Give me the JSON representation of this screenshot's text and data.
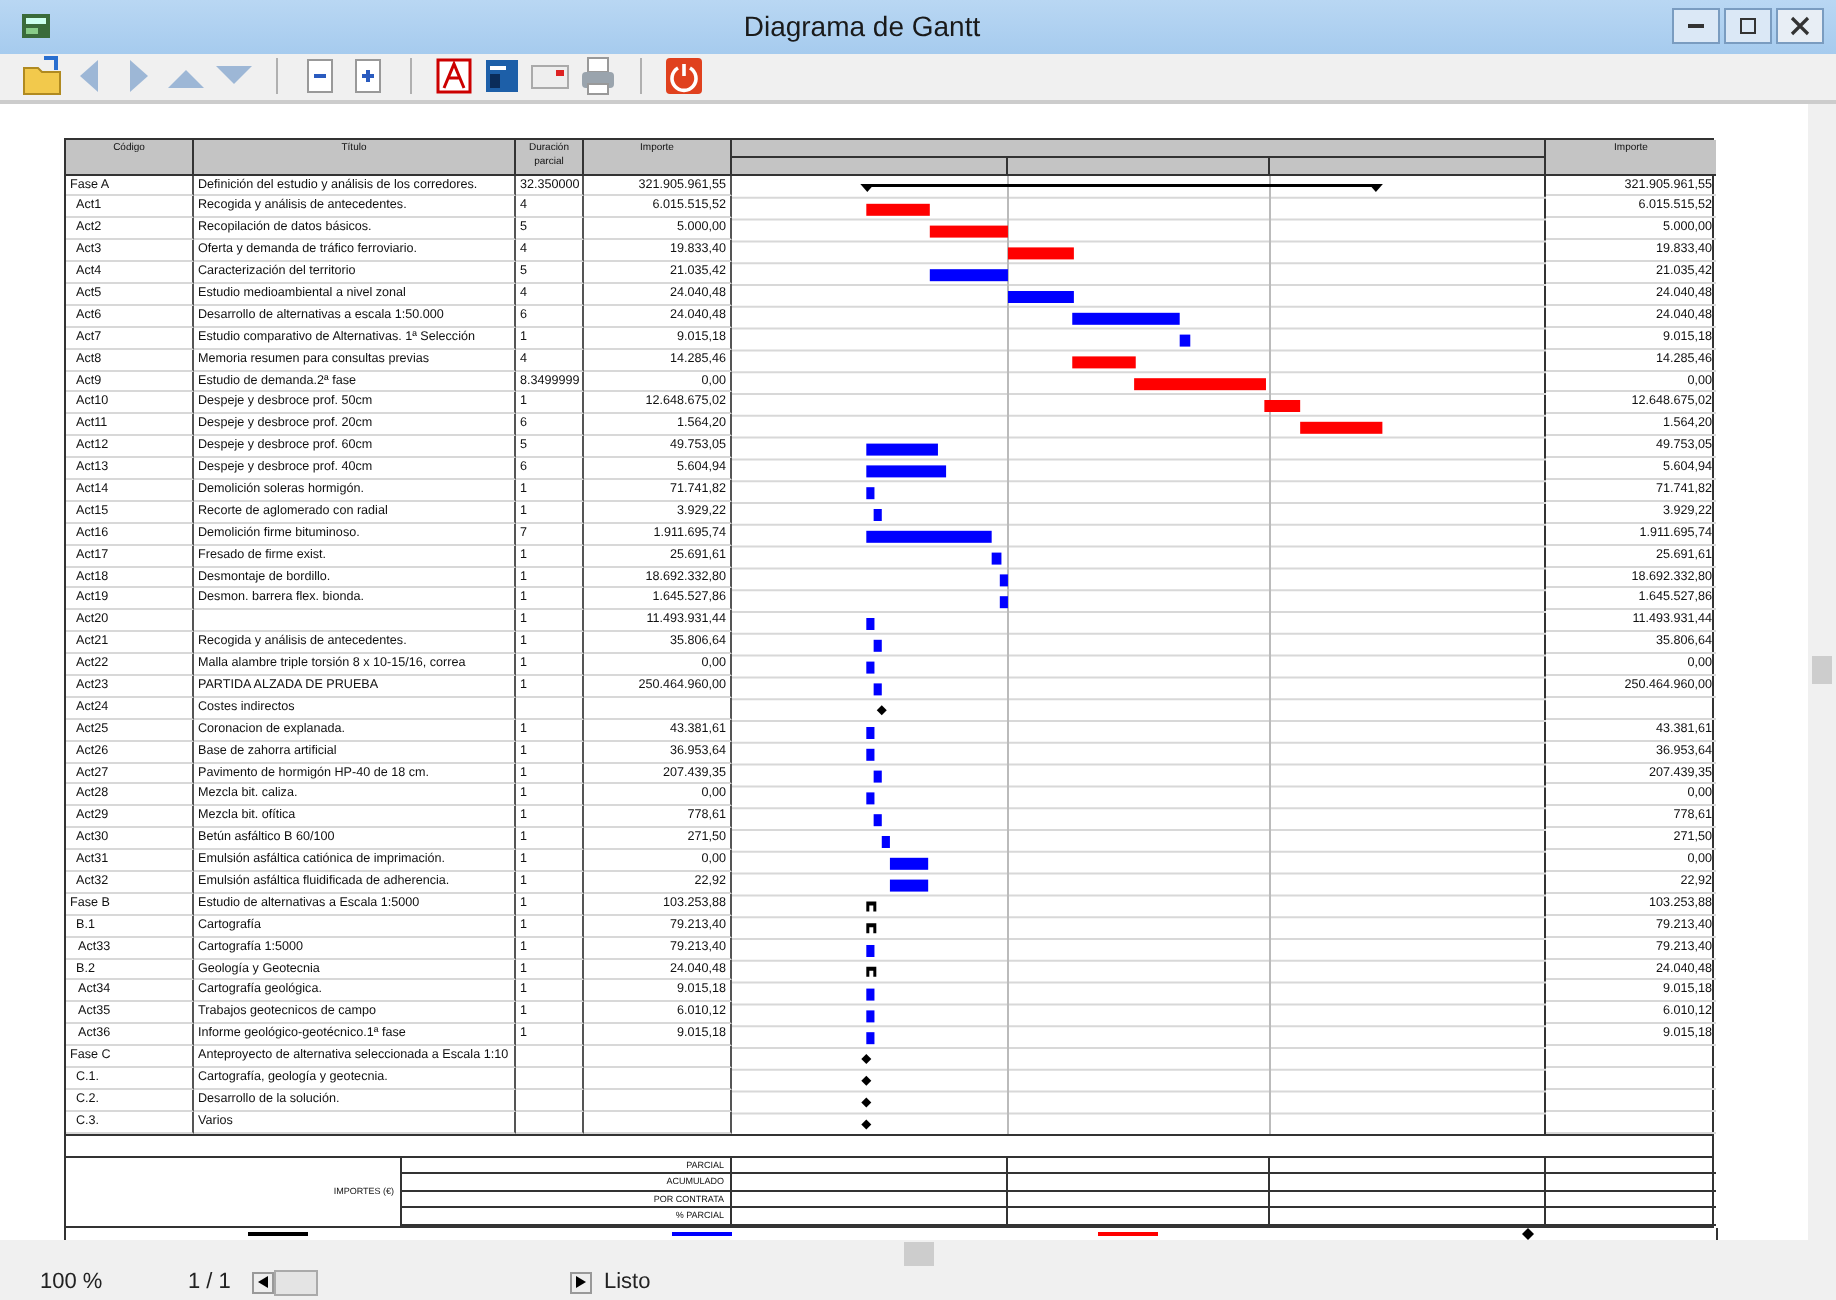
{
  "window": {
    "title": "Diagrama de Gantt"
  },
  "toolbar": [
    {
      "kind": "export"
    },
    {
      "kind": "left"
    },
    {
      "kind": "right"
    },
    {
      "kind": "up"
    },
    {
      "kind": "down"
    },
    {
      "kind": "sep"
    },
    {
      "kind": "zoomout"
    },
    {
      "kind": "zoomin"
    },
    {
      "kind": "sep"
    },
    {
      "kind": "pdf"
    },
    {
      "kind": "sheet"
    },
    {
      "kind": "mail"
    },
    {
      "kind": "print"
    },
    {
      "kind": "sep"
    },
    {
      "kind": "power"
    }
  ],
  "table": {
    "columns": [
      "Código",
      "Título",
      "Duración parcial",
      "Importe",
      "Importe"
    ],
    "rows": [
      {
        "code": "Fase A",
        "title": "Definición del estudio y análisis de los corredores.",
        "duration": "32.350000",
        "amount": "321.905.961,55",
        "total": "321.905.961,55",
        "kind": "summary",
        "children": [
          {
            "code": "Act1",
            "title": "Recogida y análisis de antecedentes.",
            "duration": "4",
            "amount": "6.015.515,52",
            "total": "6.015.515,52",
            "kind": "critical"
          },
          {
            "code": "Act2",
            "title": "Recopilación de datos básicos.",
            "duration": "5",
            "amount": "5.000,00",
            "total": "5.000,00",
            "kind": "critical"
          },
          {
            "code": "Act3",
            "title": "Oferta y demanda de tráfico ferroviario.",
            "duration": "4",
            "amount": "19.833,40",
            "total": "19.833,40",
            "kind": "critical"
          },
          {
            "code": "Act4",
            "title": "Caracterización del territorio",
            "duration": "5",
            "amount": "21.035,42",
            "total": "21.035,42",
            "kind": "task"
          },
          {
            "code": "Act5",
            "title": "Estudio medioambiental a nivel zonal",
            "duration": "4",
            "amount": "24.040,48",
            "total": "24.040,48",
            "kind": "task"
          },
          {
            "code": "Act6",
            "title": "Desarrollo de alternativas a escala 1:50.000",
            "duration": "6",
            "amount": "24.040,48",
            "total": "24.040,48",
            "kind": "task"
          },
          {
            "code": "Act7",
            "title": "Estudio comparativo de Alternativas. 1ª Selección",
            "duration": "1",
            "amount": "9.015,18",
            "total": "9.015,18",
            "kind": "task"
          },
          {
            "code": "Act8",
            "title": "Memoria resumen para consultas previas",
            "duration": "4",
            "amount": "14.285,46",
            "total": "14.285,46",
            "kind": "critical"
          },
          {
            "code": "Act9",
            "title": "Estudio de demanda.2ª fase",
            "duration": "8.3499999",
            "amount": "0,00",
            "total": "0,00",
            "kind": "critical"
          },
          {
            "code": "Act10",
            "title": "Despeje y desbroce prof. 50cm",
            "duration": "1",
            "amount": "12.648.675,02",
            "total": "12.648.675,02",
            "kind": "critical"
          },
          {
            "code": "Act11",
            "title": "Despeje y desbroce prof. 20cm",
            "duration": "6",
            "amount": "1.564,20",
            "total": "1.564,20",
            "kind": "critical"
          },
          {
            "code": "Act12",
            "title": "Despeje y desbroce prof. 60cm",
            "duration": "5",
            "amount": "49.753,05",
            "total": "49.753,05",
            "kind": "task"
          },
          {
            "code": "Act13",
            "title": "Despeje y desbroce prof. 40cm",
            "duration": "6",
            "amount": "5.604,94",
            "total": "5.604,94",
            "kind": "task"
          },
          {
            "code": "Act14",
            "title": "Demolición soleras hormigón.",
            "duration": "1",
            "amount": "71.741,82",
            "total": "71.741,82",
            "kind": "task"
          },
          {
            "code": "Act15",
            "title": "Recorte de aglomerado con radial",
            "duration": "1",
            "amount": "3.929,22",
            "total": "3.929,22",
            "kind": "task"
          },
          {
            "code": "Act16",
            "title": "Demolición firme bituminoso.",
            "duration": "7",
            "amount": "1.911.695,74",
            "total": "1.911.695,74",
            "kind": "task"
          },
          {
            "code": "Act17",
            "title": "Fresado de firme exist.",
            "duration": "1",
            "amount": "25.691,61",
            "total": "25.691,61",
            "kind": "task"
          },
          {
            "code": "Act18",
            "title": "Desmontaje de bordillo.",
            "duration": "1",
            "amount": "18.692.332,80",
            "total": "18.692.332,80",
            "kind": "task"
          },
          {
            "code": "Act19",
            "title": "Desmon. barrera flex. bionda.",
            "duration": "1",
            "amount": "1.645.527,86",
            "total": "1.645.527,86",
            "kind": "task"
          },
          {
            "code": "Act20",
            "duration": "1",
            "amount": "11.493.931,44",
            "total": "11.493.931,44",
            "kind": "task"
          },
          {
            "code": "Act21",
            "title": "Recogida y análisis de antecedentes.",
            "duration": "1",
            "amount": "35.806,64",
            "total": "35.806,64",
            "kind": "task"
          },
          {
            "code": "Act22",
            "title": "Malla alambre triple torsión 8 x 10-15/16, correa",
            "duration": "1",
            "amount": "0,00",
            "total": "0,00",
            "kind": "task"
          },
          {
            "code": "Act23",
            "title": "PARTIDA ALZADA DE PRUEBA",
            "duration": "1",
            "amount": "250.464.960,00",
            "total": "250.464.960,00",
            "kind": "task"
          },
          {
            "code": "Act24",
            "title": "Costes indirectos",
            "kind": "milestone"
          },
          {
            "code": "Act25",
            "title": "Coronacion de explanada.",
            "duration": "1",
            "amount": "43.381,61",
            "total": "43.381,61",
            "kind": "task"
          },
          {
            "code": "Act26",
            "title": "Base de zahorra artificial",
            "duration": "1",
            "amount": "36.953,64",
            "total": "36.953,64",
            "kind": "task"
          },
          {
            "code": "Act27",
            "title": "Pavimento de hormigón HP-40 de 18 cm.",
            "duration": "1",
            "amount": "207.439,35",
            "total": "207.439,35",
            "kind": "task"
          },
          {
            "code": "Act28",
            "title": "Mezcla bit. caliza.",
            "duration": "1",
            "amount": "0,00",
            "total": "0,00",
            "kind": "task"
          },
          {
            "code": "Act29",
            "title": "Mezcla bit. ofítica",
            "duration": "1",
            "amount": "778,61",
            "total": "778,61",
            "kind": "task"
          },
          {
            "code": "Act30",
            "title": "Betún asfáltico B 60/100",
            "duration": "1",
            "amount": "271,50",
            "total": "271,50",
            "kind": "task"
          },
          {
            "code": "Act31",
            "title": "Emulsión asfáltica catiónica de imprimación.",
            "duration": "1",
            "amount": "0,00",
            "total": "0,00",
            "kind": "task"
          },
          {
            "code": "Act32",
            "title": "Emulsión asfáltica fluidificada de adherencia.",
            "duration": "1",
            "amount": "22,92",
            "total": "22,92",
            "kind": "task"
          }
        ]
      },
      {
        "code": "Fase B",
        "title": "Estudio de alternativas a Escala 1:5000",
        "duration": "1",
        "amount": "103.253,88",
        "total": "103.253,88",
        "kind": "phase",
        "children": [
          {
            "code": "B.1",
            "title": "Cartografía",
            "duration": "1",
            "amount": "79.213,40",
            "total": "79.213,40",
            "kind": "phase",
            "children": [
              {
                "code": "Act33",
                "title": "Cartografía  1:5000",
                "duration": "1",
                "amount": "79.213,40",
                "total": "79.213,40",
                "kind": "task"
              }
            ]
          },
          {
            "code": "B.2",
            "title": "Geología y Geotecnia",
            "duration": "1",
            "amount": "24.040,48",
            "total": "24.040,48",
            "kind": "phase",
            "children": [
              {
                "code": "Act34",
                "title": "Cartografía geológica.",
                "duration": "1",
                "amount": "9.015,18",
                "total": "9.015,18",
                "kind": "task"
              },
              {
                "code": "Act35",
                "title": "Trabajos geotecnicos de campo",
                "duration": "1",
                "amount": "6.010,12",
                "total": "6.010,12",
                "kind": "task"
              },
              {
                "code": "Act36",
                "title": "Informe geológico-geotécnico.1ª fase",
                "duration": "1",
                "amount": "9.015,18",
                "total": "9.015,18",
                "kind": "task"
              }
            ]
          }
        ]
      },
      {
        "code": "Fase C",
        "title": "Anteproyecto de alternativa seleccionada a Escala 1:10",
        "kind": "milestone",
        "children": [
          {
            "code": "C.1.",
            "title": "Cartografía, geología y geotecnia.",
            "kind": "milestone"
          },
          {
            "code": "C.2.",
            "title": "Desarrollo de la solución.",
            "kind": "milestone"
          },
          {
            "code": "C.3.",
            "title": "Varios",
            "kind": "milestone"
          }
        ]
      }
    ]
  },
  "footer": {
    "heading": "IMPORTES (€)",
    "rows": [
      "PARCIAL",
      "ACUMULADO",
      "POR CONTRATA",
      "% PARCIAL"
    ]
  },
  "legend": [
    {
      "kind": "summary"
    },
    {
      "kind": "task"
    },
    {
      "kind": "critical"
    },
    {
      "kind": "milestone"
    }
  ],
  "status_bar": {
    "zoom": "100 %",
    "page": "1 / 1",
    "state": "Listo"
  }
}
